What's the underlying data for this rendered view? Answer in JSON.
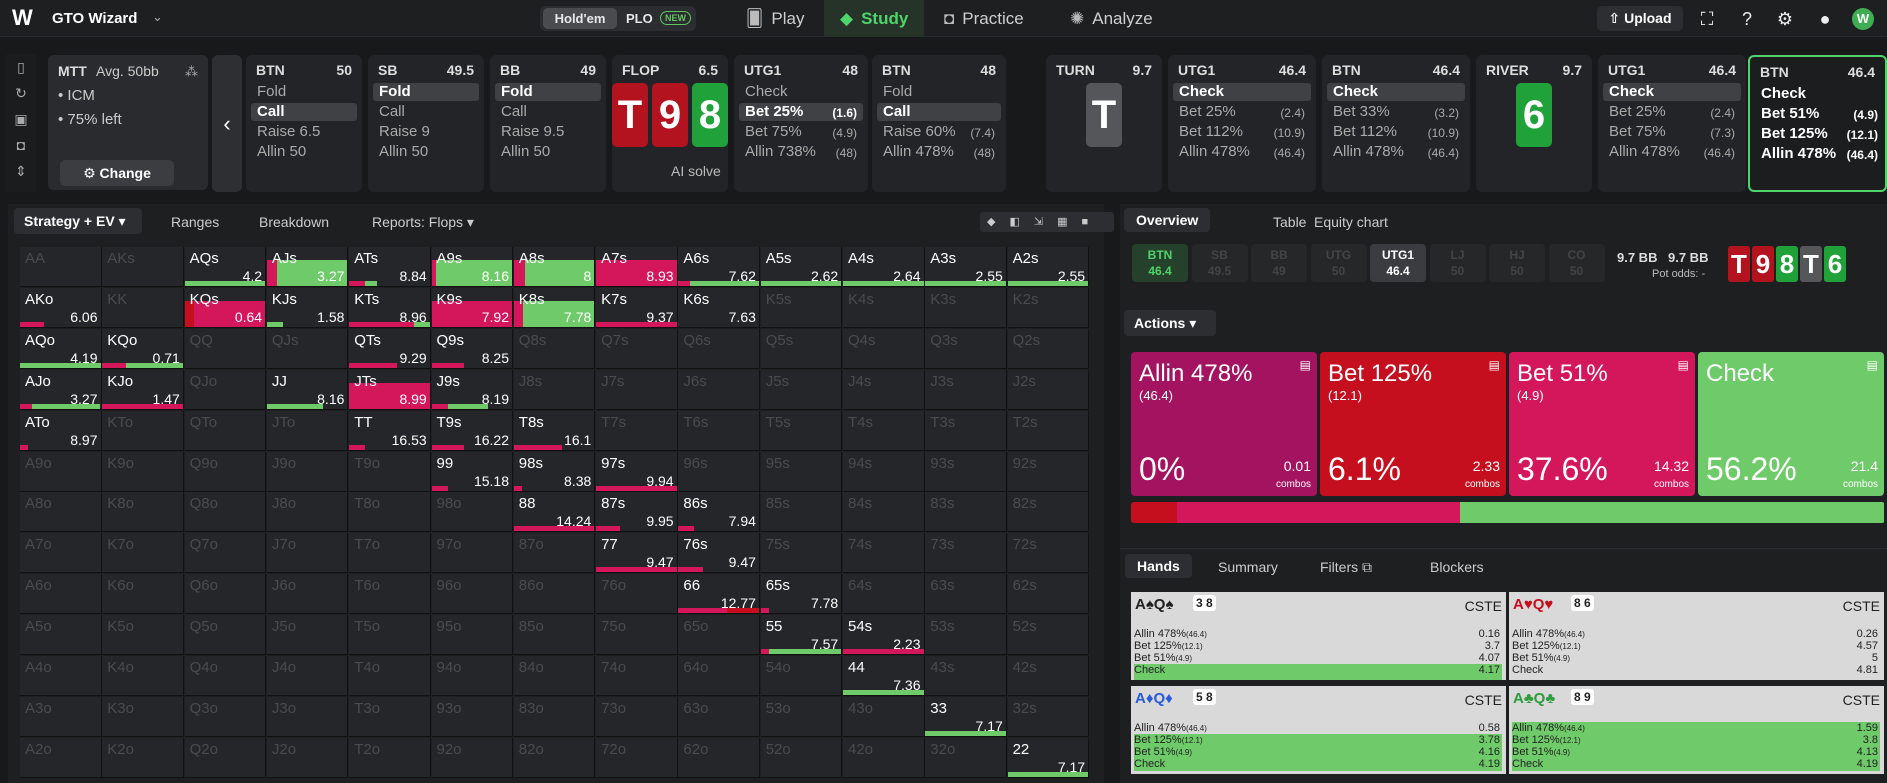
{
  "app": {
    "name": "GTO Wizard",
    "logo": "W",
    "avatar": "W"
  },
  "toggle": {
    "holdem": "Hold'em",
    "plo": "PLO",
    "new": "NEW"
  },
  "nav": {
    "play": "Play",
    "study": "Study",
    "practice": "Practice",
    "analyze": "Analyze",
    "upload": "Upload"
  },
  "mtt": {
    "title": "MTT",
    "avg": "Avg. 50bb",
    "line1": "• ICM",
    "line2": "• 75% left",
    "change": "Change"
  },
  "cards": [
    {
      "pos": "BTN",
      "stack": "50",
      "acts": [
        {
          "t": "Fold"
        },
        {
          "t": "Call",
          "sel": true
        },
        {
          "t": "Raise 6.5"
        },
        {
          "t": "Allin 50"
        }
      ]
    },
    {
      "pos": "SB",
      "stack": "49.5",
      "acts": [
        {
          "t": "Fold",
          "sel": true
        },
        {
          "t": "Call"
        },
        {
          "t": "Raise 9"
        },
        {
          "t": "Allin 50"
        }
      ]
    },
    {
      "pos": "BB",
      "stack": "49",
      "acts": [
        {
          "t": "Fold",
          "sel": true
        },
        {
          "t": "Call"
        },
        {
          "t": "Raise 9.5"
        },
        {
          "t": "Allin 50"
        }
      ]
    },
    {
      "pos": "FLOP",
      "stack": "6.5",
      "board": [
        "T",
        "9",
        "8"
      ],
      "ai": "AI solve"
    },
    {
      "pos": "UTG1",
      "stack": "48",
      "acts": [
        {
          "t": "Check"
        },
        {
          "t": "Bet 25%",
          "s": "(1.6)",
          "sel": true
        },
        {
          "t": "Bet 75%",
          "s": "(4.9)"
        },
        {
          "t": "Allin 738%",
          "s": "(48)"
        }
      ]
    },
    {
      "pos": "BTN",
      "stack": "48",
      "acts": [
        {
          "t": "Fold"
        },
        {
          "t": "Call",
          "sel": true
        },
        {
          "t": "Raise 60%",
          "s": "(7.4)"
        },
        {
          "t": "Allin 478%",
          "s": "(48)"
        }
      ]
    },
    {
      "pos": "TURN",
      "stack": "9.7",
      "board": [
        "T"
      ]
    },
    {
      "pos": "UTG1",
      "stack": "46.4",
      "acts": [
        {
          "t": "Check",
          "sel": true
        },
        {
          "t": "Bet 25%",
          "s": "(2.4)"
        },
        {
          "t": "Bet 112%",
          "s": "(10.9)"
        },
        {
          "t": "Allin 478%",
          "s": "(46.4)"
        }
      ]
    },
    {
      "pos": "BTN",
      "stack": "46.4",
      "acts": [
        {
          "t": "Check",
          "sel": true
        },
        {
          "t": "Bet 33%",
          "s": "(3.2)"
        },
        {
          "t": "Bet 112%",
          "s": "(10.9)"
        },
        {
          "t": "Allin 478%",
          "s": "(46.4)"
        }
      ]
    },
    {
      "pos": "RIVER",
      "stack": "9.7",
      "board": [
        "6"
      ]
    },
    {
      "pos": "UTG1",
      "stack": "46.4",
      "acts": [
        {
          "t": "Check",
          "sel": true
        },
        {
          "t": "Bet 25%",
          "s": "(2.4)"
        },
        {
          "t": "Bet 75%",
          "s": "(7.3)"
        },
        {
          "t": "Allin 478%",
          "s": "(46.4)"
        }
      ]
    },
    {
      "pos": "BTN",
      "stack": "46.4",
      "acts": [
        {
          "t": "Check"
        },
        {
          "t": "Bet 51%",
          "s": "(4.9)"
        },
        {
          "t": "Bet 125%",
          "s": "(12.1)"
        },
        {
          "t": "Allin 478%",
          "s": "(46.4)"
        }
      ]
    }
  ],
  "ltabs": {
    "strategy": "Strategy + EV",
    "ranges": "Ranges",
    "breakdown": "Breakdown",
    "reports": "Reports: Flops"
  },
  "grid": [
    [
      "AA",
      "",
      "d"
    ],
    [
      "AKs",
      "",
      "d"
    ],
    [
      "AQs",
      "4.2",
      ""
    ],
    [
      "AJs",
      "3.27",
      ""
    ],
    [
      "ATs",
      "8.84",
      ""
    ],
    [
      "A9s",
      "8.16",
      ""
    ],
    [
      "A8s",
      "8",
      ""
    ],
    [
      "A7s",
      "8.93",
      ""
    ],
    [
      "A6s",
      "7.62",
      ""
    ],
    [
      "A5s",
      "2.62",
      ""
    ],
    [
      "A4s",
      "2.64",
      ""
    ],
    [
      "A3s",
      "2.55",
      ""
    ],
    [
      "A2s",
      "2.55",
      ""
    ],
    [
      "AKo",
      "6.06",
      ""
    ],
    [
      "KK",
      "",
      "d"
    ],
    [
      "KQs",
      "0.64",
      ""
    ],
    [
      "KJs",
      "1.58",
      ""
    ],
    [
      "KTs",
      "8.96",
      ""
    ],
    [
      "K9s",
      "7.92",
      ""
    ],
    [
      "K8s",
      "7.78",
      ""
    ],
    [
      "K7s",
      "9.37",
      ""
    ],
    [
      "K6s",
      "7.63",
      ""
    ],
    [
      "K5s",
      "",
      "d"
    ],
    [
      "K4s",
      "",
      "d"
    ],
    [
      "K3s",
      "",
      "d"
    ],
    [
      "K2s",
      "",
      "d"
    ],
    [
      "AQo",
      "4.19",
      ""
    ],
    [
      "KQo",
      "0.71",
      ""
    ],
    [
      "QQ",
      "",
      "d"
    ],
    [
      "QJs",
      "",
      "d"
    ],
    [
      "QTs",
      "9.29",
      ""
    ],
    [
      "Q9s",
      "8.25",
      ""
    ],
    [
      "Q8s",
      "",
      "d"
    ],
    [
      "Q7s",
      "",
      "d"
    ],
    [
      "Q6s",
      "",
      "d"
    ],
    [
      "Q5s",
      "",
      "d"
    ],
    [
      "Q4s",
      "",
      "d"
    ],
    [
      "Q3s",
      "",
      "d"
    ],
    [
      "Q2s",
      "",
      "d"
    ],
    [
      "AJo",
      "3.27",
      ""
    ],
    [
      "KJo",
      "1.47",
      ""
    ],
    [
      "QJo",
      "",
      "d"
    ],
    [
      "JJ",
      "8.16",
      ""
    ],
    [
      "JTs",
      "8.99",
      ""
    ],
    [
      "J9s",
      "8.19",
      ""
    ],
    [
      "J8s",
      "",
      "d"
    ],
    [
      "J7s",
      "",
      "d"
    ],
    [
      "J6s",
      "",
      "d"
    ],
    [
      "J5s",
      "",
      "d"
    ],
    [
      "J4s",
      "",
      "d"
    ],
    [
      "J3s",
      "",
      "d"
    ],
    [
      "J2s",
      "",
      "d"
    ],
    [
      "ATo",
      "8.97",
      ""
    ],
    [
      "KTo",
      "",
      "d"
    ],
    [
      "QTo",
      "",
      "d"
    ],
    [
      "JTo",
      "",
      "d"
    ],
    [
      "TT",
      "16.53",
      ""
    ],
    [
      "T9s",
      "16.22",
      ""
    ],
    [
      "T8s",
      "16.1",
      ""
    ],
    [
      "T7s",
      "",
      "d"
    ],
    [
      "T6s",
      "",
      "d"
    ],
    [
      "T5s",
      "",
      "d"
    ],
    [
      "T4s",
      "",
      "d"
    ],
    [
      "T3s",
      "",
      "d"
    ],
    [
      "T2s",
      "",
      "d"
    ],
    [
      "A9o",
      "",
      "d"
    ],
    [
      "K9o",
      "",
      "d"
    ],
    [
      "Q9o",
      "",
      "d"
    ],
    [
      "J9o",
      "",
      "d"
    ],
    [
      "T9o",
      "",
      "d"
    ],
    [
      "99",
      "15.18",
      ""
    ],
    [
      "98s",
      "8.38",
      ""
    ],
    [
      "97s",
      "9.94",
      ""
    ],
    [
      "96s",
      "",
      "d"
    ],
    [
      "95s",
      "",
      "d"
    ],
    [
      "94s",
      "",
      "d"
    ],
    [
      "93s",
      "",
      "d"
    ],
    [
      "92s",
      "",
      "d"
    ],
    [
      "A8o",
      "",
      "d"
    ],
    [
      "K8o",
      "",
      "d"
    ],
    [
      "Q8o",
      "",
      "d"
    ],
    [
      "J8o",
      "",
      "d"
    ],
    [
      "T8o",
      "",
      "d"
    ],
    [
      "98o",
      "",
      "d"
    ],
    [
      "88",
      "14.24",
      ""
    ],
    [
      "87s",
      "9.95",
      ""
    ],
    [
      "86s",
      "7.94",
      ""
    ],
    [
      "85s",
      "",
      "d"
    ],
    [
      "84s",
      "",
      "d"
    ],
    [
      "83s",
      "",
      "d"
    ],
    [
      "82s",
      "",
      "d"
    ],
    [
      "A7o",
      "",
      "d"
    ],
    [
      "K7o",
      "",
      "d"
    ],
    [
      "Q7o",
      "",
      "d"
    ],
    [
      "J7o",
      "",
      "d"
    ],
    [
      "T7o",
      "",
      "d"
    ],
    [
      "97o",
      "",
      "d"
    ],
    [
      "87o",
      "",
      "d"
    ],
    [
      "77",
      "9.47",
      ""
    ],
    [
      "76s",
      "9.47",
      ""
    ],
    [
      "75s",
      "",
      "d"
    ],
    [
      "74s",
      "",
      "d"
    ],
    [
      "73s",
      "",
      "d"
    ],
    [
      "72s",
      "",
      "d"
    ],
    [
      "A6o",
      "",
      "d"
    ],
    [
      "K6o",
      "",
      "d"
    ],
    [
      "Q6o",
      "",
      "d"
    ],
    [
      "J6o",
      "",
      "d"
    ],
    [
      "T6o",
      "",
      "d"
    ],
    [
      "96o",
      "",
      "d"
    ],
    [
      "86o",
      "",
      "d"
    ],
    [
      "76o",
      "",
      "d"
    ],
    [
      "66",
      "12.77",
      ""
    ],
    [
      "65s",
      "7.78",
      ""
    ],
    [
      "64s",
      "",
      "d"
    ],
    [
      "63s",
      "",
      "d"
    ],
    [
      "62s",
      "",
      "d"
    ],
    [
      "A5o",
      "",
      "d"
    ],
    [
      "K5o",
      "",
      "d"
    ],
    [
      "Q5o",
      "",
      "d"
    ],
    [
      "J5o",
      "",
      "d"
    ],
    [
      "T5o",
      "",
      "d"
    ],
    [
      "95o",
      "",
      "d"
    ],
    [
      "85o",
      "",
      "d"
    ],
    [
      "75o",
      "",
      "d"
    ],
    [
      "65o",
      "",
      "d"
    ],
    [
      "55",
      "7.57",
      ""
    ],
    [
      "54s",
      "2.23",
      ""
    ],
    [
      "53s",
      "",
      "d"
    ],
    [
      "52s",
      "",
      "d"
    ],
    [
      "A4o",
      "",
      "d"
    ],
    [
      "K4o",
      "",
      "d"
    ],
    [
      "Q4o",
      "",
      "d"
    ],
    [
      "J4o",
      "",
      "d"
    ],
    [
      "T4o",
      "",
      "d"
    ],
    [
      "94o",
      "",
      "d"
    ],
    [
      "84o",
      "",
      "d"
    ],
    [
      "74o",
      "",
      "d"
    ],
    [
      "64o",
      "",
      "d"
    ],
    [
      "54o",
      "",
      "d"
    ],
    [
      "44",
      "7.36",
      ""
    ],
    [
      "43s",
      "",
      "d"
    ],
    [
      "42s",
      "",
      "d"
    ],
    [
      "A3o",
      "",
      "d"
    ],
    [
      "K3o",
      "",
      "d"
    ],
    [
      "Q3o",
      "",
      "d"
    ],
    [
      "J3o",
      "",
      "d"
    ],
    [
      "T3o",
      "",
      "d"
    ],
    [
      "93o",
      "",
      "d"
    ],
    [
      "83o",
      "",
      "d"
    ],
    [
      "73o",
      "",
      "d"
    ],
    [
      "63o",
      "",
      "d"
    ],
    [
      "53o",
      "",
      "d"
    ],
    [
      "43o",
      "",
      "d"
    ],
    [
      "33",
      "7.17",
      ""
    ],
    [
      "32s",
      "",
      "d"
    ],
    [
      "A2o",
      "",
      "d"
    ],
    [
      "K2o",
      "",
      "d"
    ],
    [
      "Q2o",
      "",
      "d"
    ],
    [
      "J2o",
      "",
      "d"
    ],
    [
      "T2o",
      "",
      "d"
    ],
    [
      "92o",
      "",
      "d"
    ],
    [
      "82o",
      "",
      "d"
    ],
    [
      "72o",
      "",
      "d"
    ],
    [
      "62o",
      "",
      "d"
    ],
    [
      "52o",
      "",
      "d"
    ],
    [
      "42o",
      "",
      "d"
    ],
    [
      "32o",
      "",
      "d"
    ],
    [
      "22",
      "7.17",
      ""
    ]
  ],
  "rtabs": {
    "overview": "Overview",
    "table": "Table",
    "equity": "Equity chart",
    "hands": "Hands",
    "summary": "Summary",
    "filters": "Filters",
    "blockers": "Blockers",
    "actions": "Actions"
  },
  "positions": [
    {
      "p": "BTN",
      "s": "46.4",
      "st": "act1"
    },
    {
      "p": "SB",
      "s": "49.5",
      "st": ""
    },
    {
      "p": "BB",
      "s": "49",
      "st": ""
    },
    {
      "p": "UTG",
      "s": "50",
      "st": ""
    },
    {
      "p": "UTG1",
      "s": "46.4",
      "st": "act2"
    },
    {
      "p": "LJ",
      "s": "50",
      "st": ""
    },
    {
      "p": "HJ",
      "s": "50",
      "st": ""
    },
    {
      "p": "CO",
      "s": "50",
      "st": ""
    }
  ],
  "pot": {
    "a": "9.7 BB",
    "b": "9.7 BB",
    "odds": "Pot odds:",
    "oddsval": "-"
  },
  "board": [
    "T",
    "9",
    "8",
    "T",
    "6"
  ],
  "actions": [
    {
      "t": "Allin 478%",
      "s": "(46.4)",
      "p": "0%",
      "c": "0.01",
      "cl": "combos",
      "col": "#a3135f"
    },
    {
      "t": "Bet 125%",
      "s": "(12.1)",
      "p": "6.1%",
      "c": "2.33",
      "cl": "combos",
      "col": "#c50f1f"
    },
    {
      "t": "Bet 51%",
      "s": "(4.9)",
      "p": "37.6%",
      "c": "14.32",
      "cl": "combos",
      "col": "#d4165a"
    },
    {
      "t": "Check",
      "s": "",
      "p": "56.2%",
      "c": "21.4",
      "cl": "combos",
      "col": "#6fcb6a"
    }
  ],
  "strategy_mix": [
    0,
    6.1,
    37.6,
    56.2
  ],
  "hands": [
    {
      "h": "A♠Q♠",
      "b1": "3",
      "b2": "8",
      "cste": "CSTE",
      "rows": [
        [
          "Allin 478%",
          "(46.4)",
          "0.16"
        ],
        [
          "Bet 125%",
          "(12.1)",
          "3.7"
        ],
        [
          "Bet 51%",
          "(4.9)",
          "4.07"
        ],
        [
          "Check",
          "",
          "4.17"
        ]
      ],
      "hl": [
        3
      ]
    },
    {
      "h": "A♥Q♥",
      "b1": "8",
      "b2": "6",
      "cste": "CSTE",
      "rows": [
        [
          "Allin 478%",
          "(46.4)",
          "0.26"
        ],
        [
          "Bet 125%",
          "(12.1)",
          "4.57"
        ],
        [
          "Bet 51%",
          "(4.9)",
          "5"
        ],
        [
          "Check",
          "",
          "4.81"
        ]
      ],
      "hl": []
    },
    {
      "h": "A♦Q♦",
      "b1": "5",
      "b2": "8",
      "cste": "CSTE",
      "rows": [
        [
          "Allin 478%",
          "(46.4)",
          "0.58"
        ],
        [
          "Bet 125%",
          "(12.1)",
          "3.78"
        ],
        [
          "Bet 51%",
          "(4.9)",
          "4.16"
        ],
        [
          "Check",
          "",
          "4.19"
        ]
      ],
      "hl": [
        1,
        2,
        3
      ]
    },
    {
      "h": "A♣Q♣",
      "b1": "8",
      "b2": "9",
      "cste": "CSTE",
      "rows": [
        [
          "Allin 478%",
          "(46.4)",
          "1.59"
        ],
        [
          "Bet 125%",
          "(12.1)",
          "3.8"
        ],
        [
          "Bet 51%",
          "(4.9)",
          "4.13"
        ],
        [
          "Check",
          "",
          "4.19"
        ]
      ],
      "hl": [
        0,
        1,
        2,
        3
      ]
    }
  ],
  "colors": {
    "accent": "#4fd46a",
    "allin": "#a3135f",
    "bet_big": "#c50f1f",
    "bet_small": "#d4165a",
    "check": "#6fcb6a"
  }
}
